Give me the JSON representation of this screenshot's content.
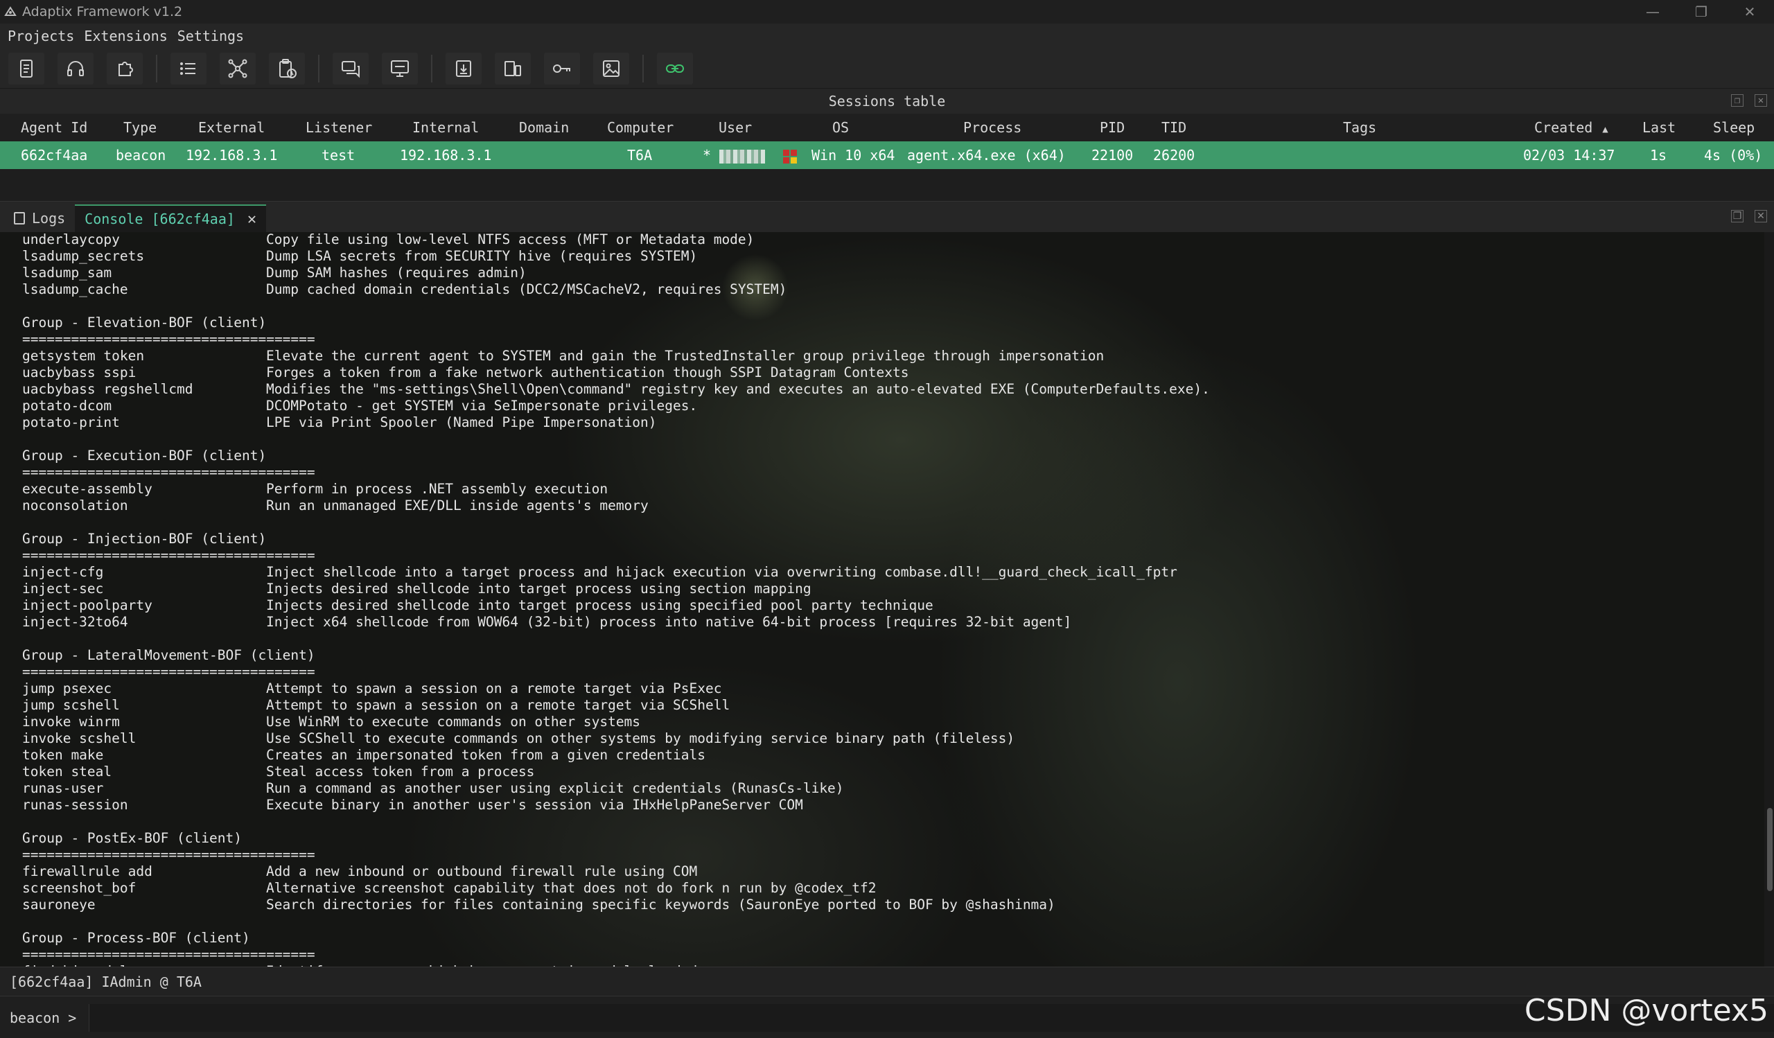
{
  "window": {
    "title": "Adaptix Framework v1.2",
    "controls": [
      "—",
      "❐",
      "✕"
    ]
  },
  "menu": [
    "Projects",
    "Extensions",
    "Settings"
  ],
  "toolbar": {
    "buttons": [
      "document-icon",
      "headset-icon",
      "puzzle-icon",
      "list-icon",
      "graph-icon",
      "clipboard-clock-icon",
      "chat-icon",
      "terminal-screen-icon",
      "download-box-icon",
      "device-icon",
      "key-icon",
      "image-icon",
      "link-icon"
    ]
  },
  "sessions": {
    "title": "Sessions table",
    "columns": [
      "Agent Id",
      "Type",
      "External",
      "Listener",
      "Internal",
      "Domain",
      "Computer",
      "User",
      "OS",
      "Process",
      "PID",
      "TID",
      "Tags",
      "Created",
      "Last",
      "Sleep"
    ],
    "sort_indicator": "▲",
    "row": {
      "agent_id": "662cf4aa",
      "type": "beacon",
      "external": "192.168.3.1",
      "listener": "test",
      "internal": "192.168.3.1",
      "domain": "",
      "computer": "T6A",
      "user": "*",
      "os": "Win 10 x64",
      "process": "agent.x64.exe (x64)",
      "pid": "22100",
      "tid": "26200",
      "tags": "",
      "created": "02/03 14:37",
      "last": "1s",
      "sleep": "4s (0%)"
    },
    "highlight_color": "#3e9a6a"
  },
  "tabs": [
    {
      "label": "Logs",
      "active": false
    },
    {
      "label": "Console [662cf4aa]",
      "active": true
    }
  ],
  "console": {
    "lines": [
      [
        "underlaycopy",
        "Copy file using low-level NTFS access (MFT or Metadata mode)"
      ],
      [
        "lsadump_secrets",
        "Dump LSA secrets from SECURITY hive (requires SYSTEM)"
      ],
      [
        "lsadump_sam",
        "Dump SAM hashes (requires admin)"
      ],
      [
        "lsadump_cache",
        "Dump cached domain credentials (DCC2/MSCacheV2, requires SYSTEM)"
      ],
      [
        "",
        ""
      ],
      [
        "Group - Elevation-BOF (client)",
        ""
      ],
      [
        "====================================",
        ""
      ],
      [
        "getsystem token",
        "Elevate the current agent to SYSTEM and gain the TrustedInstaller group privilege through impersonation"
      ],
      [
        "uacbybass sspi",
        "Forges a token from a fake network authentication though SSPI Datagram Contexts"
      ],
      [
        "uacbybass regshellcmd",
        "Modifies the \"ms-settings\\Shell\\Open\\command\" registry key and executes an auto-elevated EXE (ComputerDefaults.exe)."
      ],
      [
        "potato-dcom",
        "DCOMPotato - get SYSTEM via SeImpersonate privileges."
      ],
      [
        "potato-print",
        "LPE via Print Spooler (Named Pipe Impersonation)"
      ],
      [
        "",
        ""
      ],
      [
        "Group - Execution-BOF (client)",
        ""
      ],
      [
        "====================================",
        ""
      ],
      [
        "execute-assembly",
        "Perform in process .NET assembly execution"
      ],
      [
        "noconsolation",
        "Run an unmanaged EXE/DLL inside agents's memory"
      ],
      [
        "",
        ""
      ],
      [
        "Group - Injection-BOF (client)",
        ""
      ],
      [
        "====================================",
        ""
      ],
      [
        "inject-cfg",
        "Inject shellcode into a target process and hijack execution via overwriting combase.dll!__guard_check_icall_fptr"
      ],
      [
        "inject-sec",
        "Injects desired shellcode into target process using section mapping"
      ],
      [
        "inject-poolparty",
        "Injects desired shellcode into target process using specified pool party technique"
      ],
      [
        "inject-32to64",
        "Inject x64 shellcode from WOW64 (32-bit) process into native 64-bit process [requires 32-bit agent]"
      ],
      [
        "",
        ""
      ],
      [
        "Group - LateralMovement-BOF (client)",
        ""
      ],
      [
        "====================================",
        ""
      ],
      [
        "jump psexec",
        "Attempt to spawn a session on a remote target via PsExec"
      ],
      [
        "jump scshell",
        "Attempt to spawn a session on a remote target via SCShell"
      ],
      [
        "invoke winrm",
        "Use WinRM to execute commands on other systems"
      ],
      [
        "invoke scshell",
        "Use SCShell to execute commands on other systems by modifying service binary path (fileless)"
      ],
      [
        "token make",
        "Creates an impersonated token from a given credentials"
      ],
      [
        "token steal",
        "Steal access token from a process"
      ],
      [
        "runas-user",
        "Run a command as another user using explicit credentials (RunasCs-like)"
      ],
      [
        "runas-session",
        "Execute binary in another user's session via IHxHelpPaneServer COM"
      ],
      [
        "",
        ""
      ],
      [
        "Group - PostEx-BOF (client)",
        ""
      ],
      [
        "====================================",
        ""
      ],
      [
        "firewallrule add",
        "Add a new inbound or outbound firewall rule using COM"
      ],
      [
        "screenshot_bof",
        "Alternative screenshot capability that does not do fork n run by @codex_tf2"
      ],
      [
        "sauroneye",
        "Search directories for files containing specific keywords (SauronEye ported to BOF by @shashinma)"
      ],
      [
        "",
        ""
      ],
      [
        "Group - Process-BOF (client)",
        ""
      ],
      [
        "====================================",
        ""
      ],
      [
        "findobj module",
        "Identify processes which have a certain module loaded"
      ]
    ]
  },
  "status_line": "[662cf4aa] IAdmin @ T6A",
  "prompt": {
    "label": "beacon >",
    "value": ""
  },
  "watermark": "CSDN @vortex5"
}
